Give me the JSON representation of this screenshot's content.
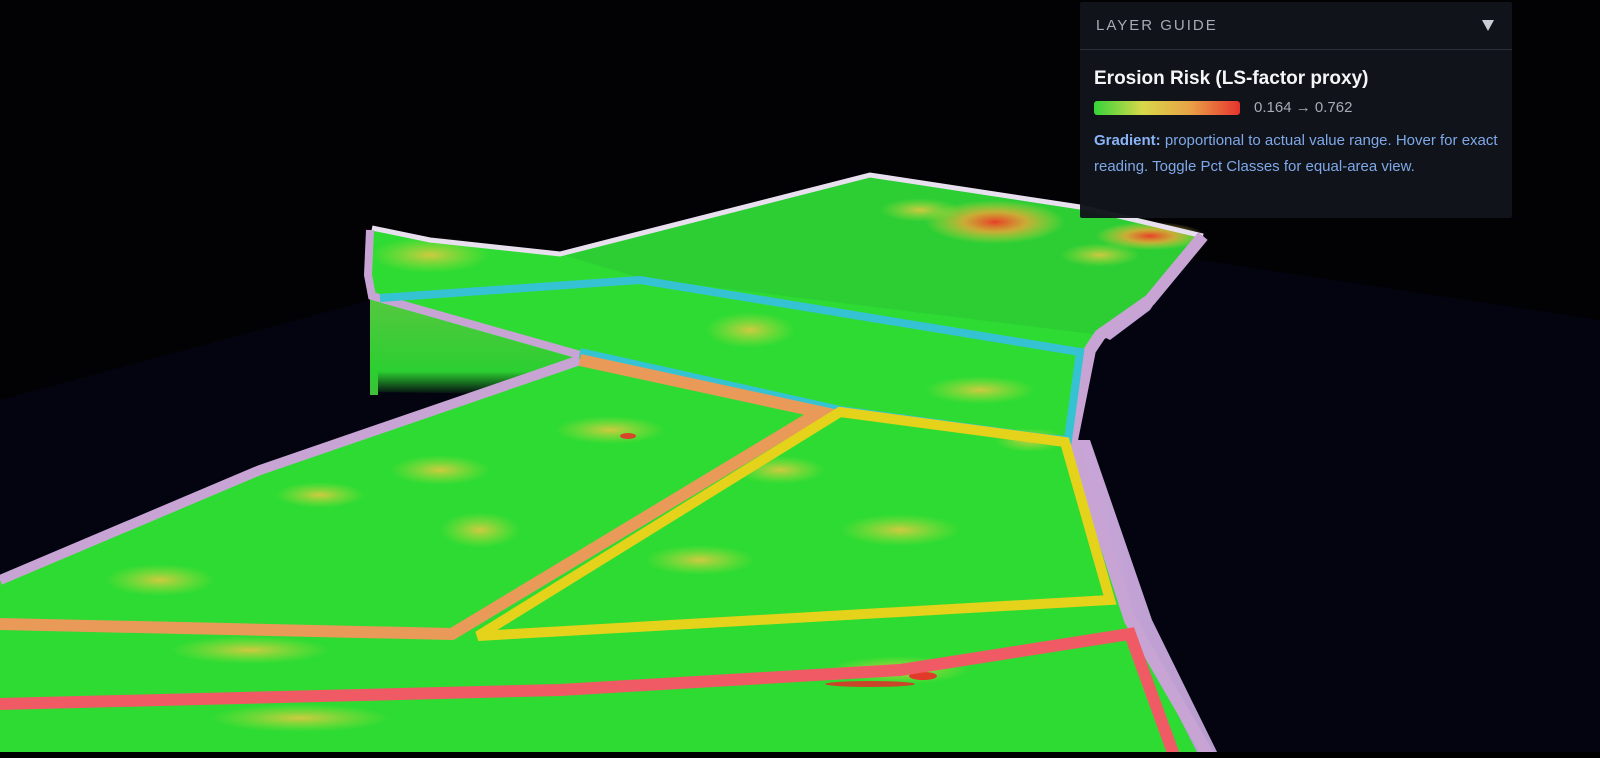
{
  "layer_guide": {
    "title": "LAYER GUIDE",
    "collapse_icon": "triangle-down-icon",
    "layer_name": "Erosion Risk (LS-factor proxy)",
    "legend": {
      "range_text": "0.164 → 0.762",
      "min": 0.164,
      "max": 0.762,
      "gradient_colors": [
        "#35d43a",
        "#d8d84a",
        "#e9a046",
        "#e7332f"
      ]
    },
    "note_label": "Gradient:",
    "note_text": " proportional to actual value range. Hover for exact reading. Toggle Pct Classes for equal-area view."
  },
  "map": {
    "surface_color": "#2fdc32",
    "boundary_colors": {
      "outer": "#c7a4d4",
      "blue": "#35c3d3",
      "orange": "#e99a58",
      "yellow": "#e5d21a",
      "red": "#f05a64"
    }
  }
}
